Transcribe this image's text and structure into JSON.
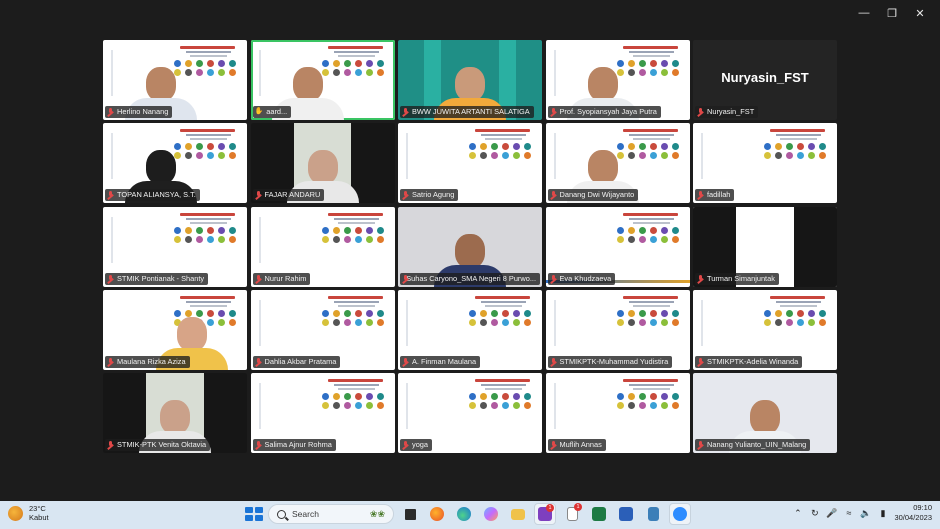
{
  "window": {
    "controls": [
      "minimize",
      "restore",
      "close"
    ]
  },
  "participants": [
    {
      "name": "Herlino Nanang",
      "type": "person-slide",
      "muted": true
    },
    {
      "name": "aard...",
      "type": "person-slide",
      "muted": false,
      "active": true
    },
    {
      "name": "BWW JUWITA ARTANTI SALATIGA",
      "type": "person-teal",
      "muted": true
    },
    {
      "name": "Prof. Syopiansyah Jaya Putra",
      "type": "person-slide",
      "muted": true
    },
    {
      "name": "Nuryasin_FST",
      "type": "namecard",
      "muted": true,
      "card_text": "Nuryasin_FST"
    },
    {
      "name": "TOPAN ALIANSYA, S.T.",
      "type": "person-slide",
      "muted": true
    },
    {
      "name": "FAJAR ANDARU",
      "type": "person-dark",
      "muted": true
    },
    {
      "name": "Satrio Agung",
      "type": "slide",
      "muted": true
    },
    {
      "name": "Danang Dwi Wijayanto",
      "type": "person-slide",
      "muted": true
    },
    {
      "name": "fadillah",
      "type": "slide",
      "muted": true
    },
    {
      "name": "STMIK Pontianak - Shanty",
      "type": "slide",
      "muted": true
    },
    {
      "name": "Nurur Rahim",
      "type": "slide",
      "muted": true
    },
    {
      "name": "Suhas Caryono_SMA Negeri 8 Purwo...",
      "type": "person-grey",
      "muted": true
    },
    {
      "name": "Eva Khudzaeva",
      "type": "slide-alt",
      "muted": true
    },
    {
      "name": "Turman Simanjuntak",
      "type": "slide-dark",
      "muted": true
    },
    {
      "name": "Maulana Rizka Aziza",
      "type": "person-slide-partial",
      "muted": true
    },
    {
      "name": "Dahlia Akbar Pratama",
      "type": "slide",
      "muted": true
    },
    {
      "name": "A. Finman Maulana",
      "type": "slide",
      "muted": true
    },
    {
      "name": "STMIKPTK-Muhammad Yudistira",
      "type": "slide",
      "muted": true
    },
    {
      "name": "STMIKPTK-Adelia Winanda",
      "type": "slide",
      "muted": true
    },
    {
      "name": "STMIK-PTK Venita Oktavia",
      "type": "person-dark",
      "muted": true
    },
    {
      "name": "Salima Ajnur Rohma",
      "type": "slide",
      "muted": true
    },
    {
      "name": "yoga",
      "type": "slide",
      "muted": true
    },
    {
      "name": "Muflih Annas",
      "type": "slide",
      "muted": true
    },
    {
      "name": "Nanang Yulianto_UIN_Malang",
      "type": "person-light",
      "muted": true
    }
  ],
  "taskbar": {
    "weather_temp": "23°C",
    "weather_desc": "Kabut",
    "search_placeholder": "Search",
    "clock_time": "09:10",
    "clock_date": "30/04/2023",
    "apps": [
      "task-view-icon",
      "file-explorer-icon",
      "edge-icon",
      "firefox-icon",
      "copilot-icon",
      "folder-icon",
      "pen-app-icon",
      "notepad-icon",
      "excel-icon",
      "word-icon",
      "calculator-icon",
      "zoom-icon"
    ],
    "colors": {
      "accent": "#1a74d6",
      "bg": "#d9e6f2"
    }
  }
}
